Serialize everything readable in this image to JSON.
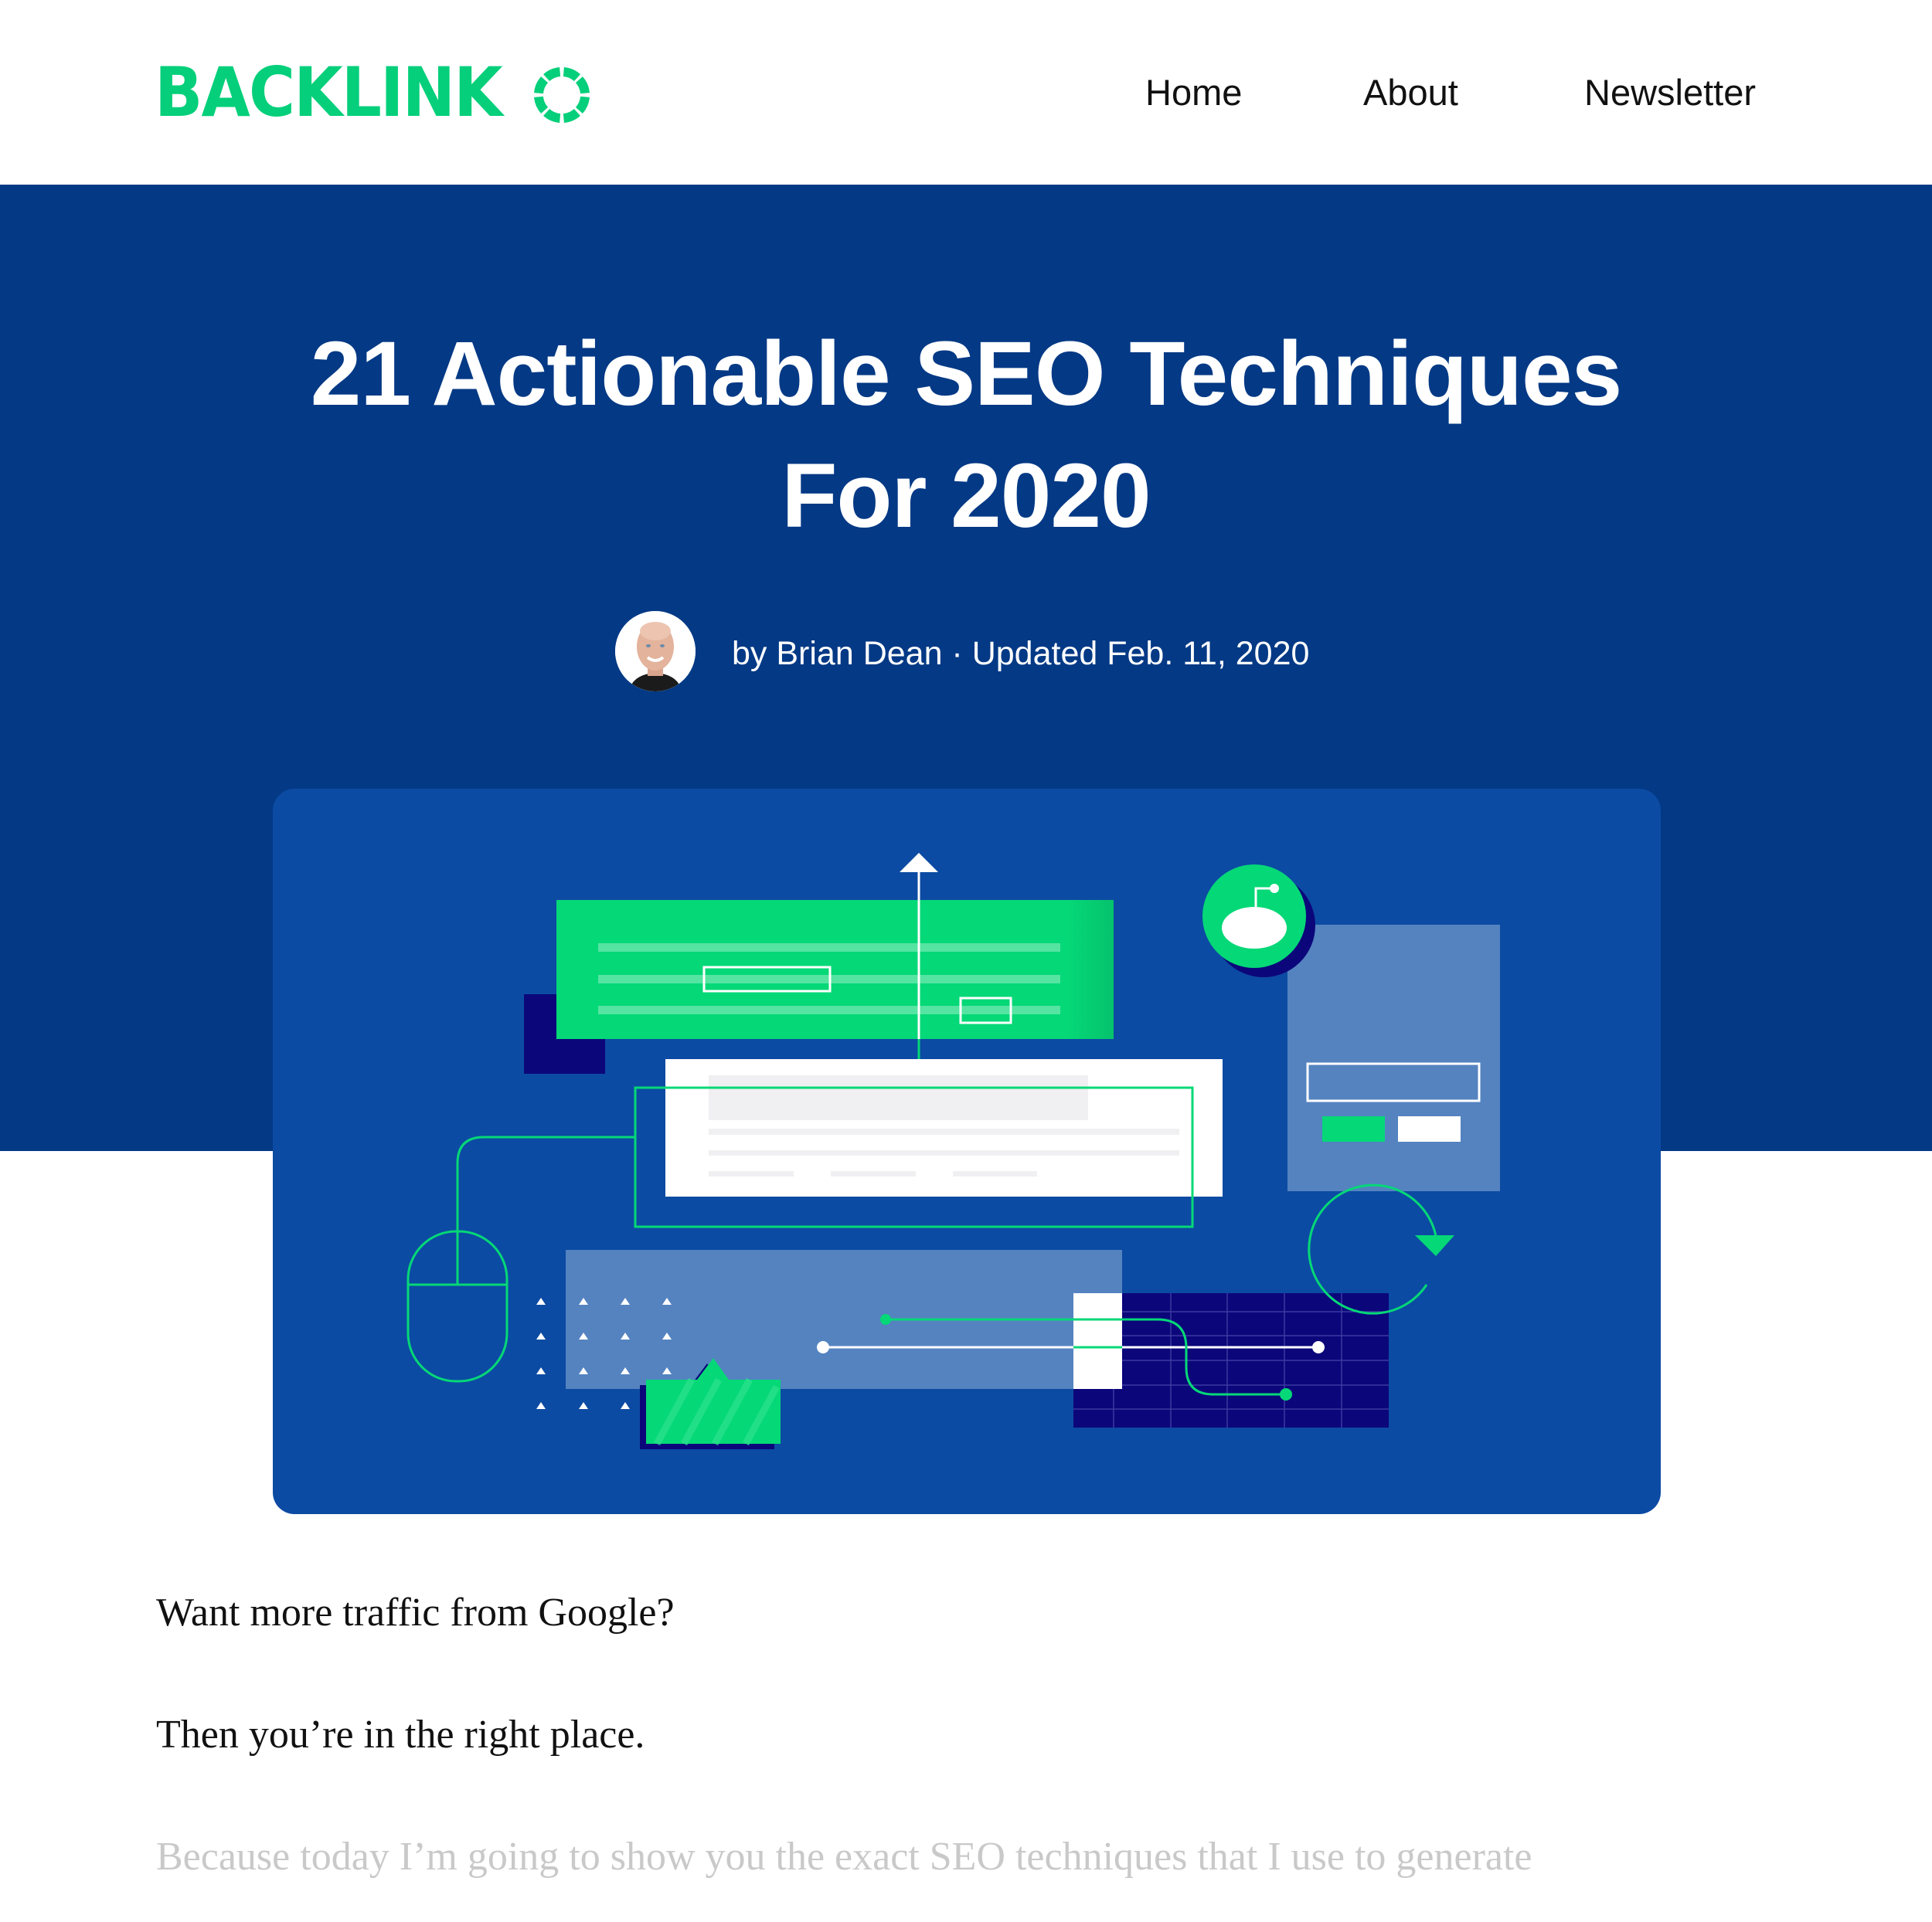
{
  "header": {
    "logo_text": "BACKLINK",
    "logo_final_glyph": "O",
    "nav": [
      {
        "label": "Home"
      },
      {
        "label": "About"
      },
      {
        "label": "Newsletter"
      }
    ]
  },
  "hero": {
    "title_line1": "21 Actionable SEO Techniques",
    "title_line2": "For 2020",
    "byline": "by Brian Dean · Updated Feb. 11, 2020",
    "author_avatar_alt": "Brian Dean"
  },
  "colors": {
    "brand_green": "#05cf7a",
    "hero_blue": "#033985",
    "card_blue": "#0c4ba3",
    "panel_light_blue": "#5483c0",
    "navy": "#0c067b"
  },
  "article": {
    "paragraphs": [
      "Want more traffic from Google?",
      "Then you’re in the right place.",
      "Because today I’m going to show you the exact SEO techniques that I use to generate"
    ]
  }
}
